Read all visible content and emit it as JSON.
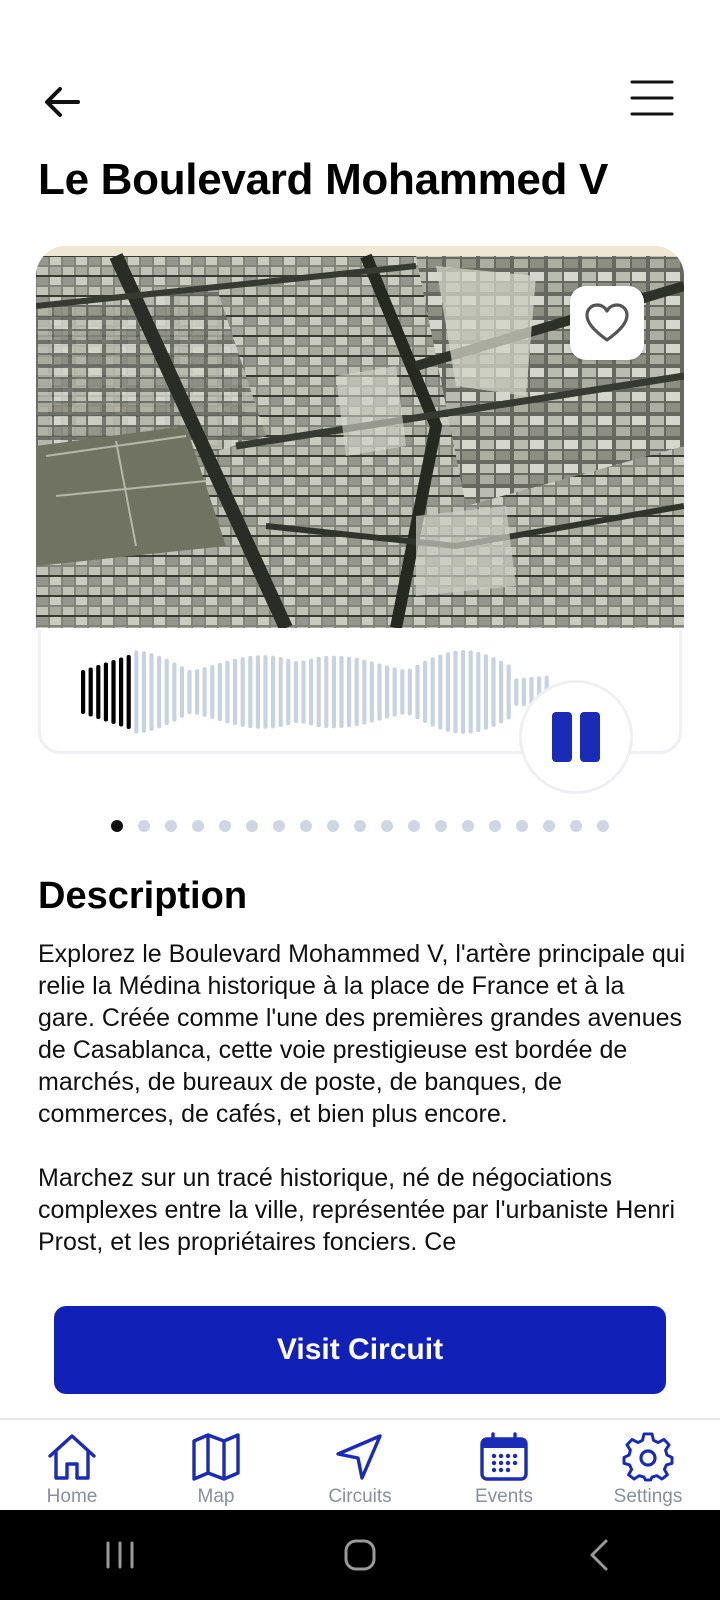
{
  "header": {
    "title": "Le Boulevard Mohammed V"
  },
  "icons": {
    "back": "arrow-left-icon",
    "menu": "hamburger-menu-icon",
    "favorite": "heart-outline-icon",
    "pause": "pause-icon"
  },
  "audio": {
    "progress": 0.11
  },
  "carousel": {
    "count": 19,
    "active_index": 0
  },
  "description": {
    "heading": "Description",
    "paragraphs": [
      "Explorez le Boulevard Mohammed V, l'artère principale qui relie la Médina historique à la place de France et à la gare. Créée comme l'une des premières grandes avenues de Casablanca, cette voie prestigieuse est bordée de marchés, de bureaux de poste, de banques, de commerces, de cafés, et bien plus encore.",
      "Marchez sur un tracé historique, né de négociations complexes entre la ville, représentée par l'urbaniste Henri Prost, et les propriétaires fonciers. Ce"
    ]
  },
  "cta": {
    "label": "Visit Circuit"
  },
  "bottom_nav": {
    "items": [
      {
        "label": "Home",
        "icon": "home-icon"
      },
      {
        "label": "Map",
        "icon": "map-icon"
      },
      {
        "label": "Circuits",
        "icon": "navigation-arrow-icon"
      },
      {
        "label": "Events",
        "icon": "calendar-icon"
      },
      {
        "label": "Settings",
        "icon": "gear-icon"
      }
    ]
  },
  "colors": {
    "accent": "#1120b7",
    "nav_icon": "#1a2bb8",
    "wave_played": "#000000",
    "wave_unplayed": "#c9d3e0"
  }
}
